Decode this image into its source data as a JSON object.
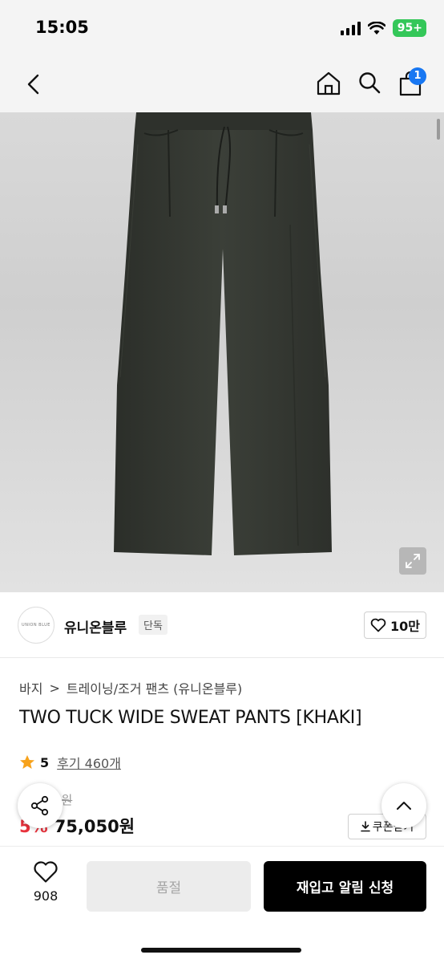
{
  "status_bar": {
    "time": "15:05",
    "battery": "95+"
  },
  "nav": {
    "cart_badge": "1"
  },
  "product_image": {
    "description_hidden": ""
  },
  "brand": {
    "logo_text": "UNION BLUE",
    "name": "유니온블루",
    "tag": "단독",
    "likes": "10만"
  },
  "breadcrumb": {
    "category": "바지",
    "separator": ">",
    "subcategory": "트레이닝/조거 팬츠 (유니온블루)"
  },
  "product": {
    "title": "TWO TUCK WIDE SWEAT PANTS [KHAKI]",
    "rating": "5",
    "reviews": "후기 460개",
    "original_price": "79,000원",
    "discount": "5%",
    "sale_price": "75,050원",
    "coupon_label": "쿠폰받기"
  },
  "bottom_bar": {
    "wish_count": "908",
    "soldout_label": "품절",
    "restock_label": "재입고 알림 신청"
  },
  "colors": {
    "accent_blue": "#1877f2",
    "discount_red": "#e8323c",
    "star": "#f7a21b",
    "battery_green": "#34c759"
  }
}
